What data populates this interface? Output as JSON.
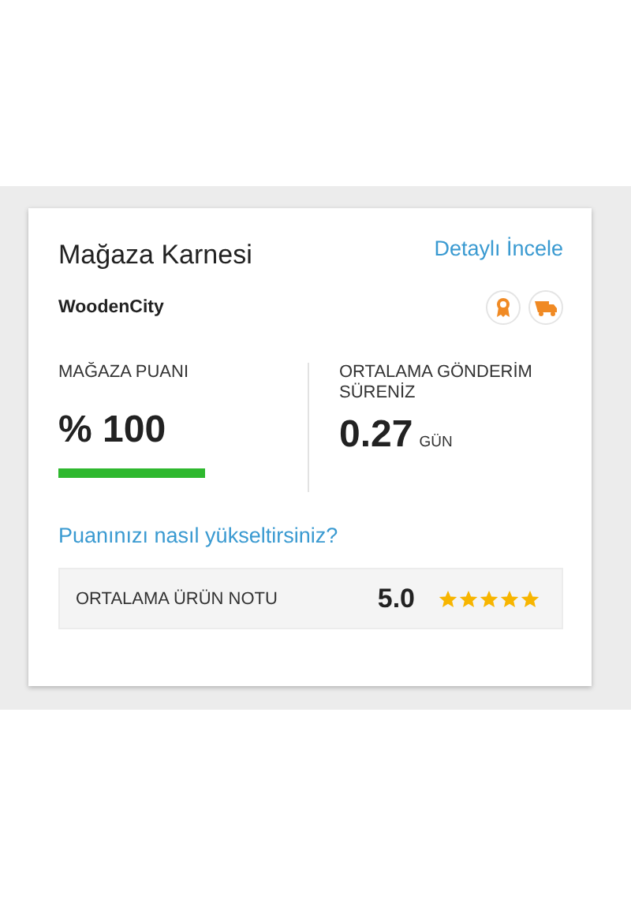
{
  "card": {
    "title": "Mağaza Karnesi",
    "detail_link": "Detaylı İncele",
    "store_name": "WoodenCity"
  },
  "metrics": [
    {
      "label": "MAĞAZA PUANI",
      "value": "% 100",
      "kind": "score"
    },
    {
      "label": "ORTALAMA GÖNDERİM SÜRENİZ",
      "value": "0.27",
      "unit": "GÜN"
    }
  ],
  "help_link": "Puanınızı nasıl yükseltirsiniz?",
  "rating": {
    "label": "ORTALAMA ÜRÜN NOTU",
    "value": "5.0",
    "stars": 5
  }
}
